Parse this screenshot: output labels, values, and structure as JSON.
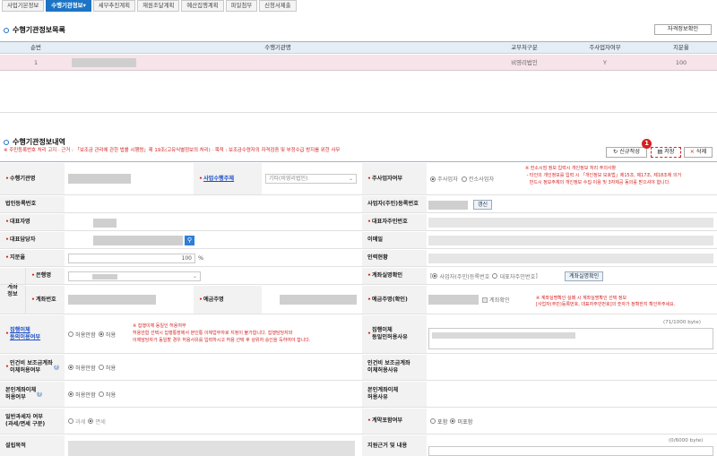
{
  "tabs": [
    "사업기본정보",
    "수행기관정보",
    "세부추진계획",
    "재원조달계획",
    "예산집행계획",
    "파일첨부",
    "신청서제출"
  ],
  "active_tab_suffix": "▾",
  "list": {
    "title": "수행기관정보목록",
    "right_button": "자격정보확인",
    "headers": [
      "순번",
      "수행기관명",
      "교부처구분",
      "주사업자여부",
      "지분율"
    ],
    "rows": [
      {
        "no": "1",
        "type": "비영리법인",
        "main": "Y",
        "share": "100"
      }
    ]
  },
  "detail": {
    "title": "수행기관정보내역",
    "subtitle": "※ 주민등록번호 처리 고지 · 근거 : 「보조금 관리에 관한 법률 시행령」제 19조(고유식별정보의 처리) · 목적 : 보조금수령자의 자격검증 및 부정수급 방지를 위한 사무",
    "buttons": {
      "new": "신규작성",
      "save": "저장",
      "delete": "삭제"
    },
    "marker": "1"
  },
  "form": {
    "org_name": "수행기관명",
    "biz_type_link": "사업수행주체",
    "biz_type_select": "기타(비영리법인)",
    "main_biz": "주사업자여부",
    "main_biz_opt1": "주사업자",
    "main_biz_opt2": "컨소사업자",
    "main_biz_note": "※ 컨소시엄 정보 입력시 개인정보 처리 주의사항\n - 타인의 개인정보를 입력 시 「개인정보 보호법」제15조, 제17조, 제18조에 의거\n   반드시 정보주체의 개인정보 수집·이용 및 3자제공 동의를 받으셔야 합니다.",
    "corp_no": "법인등록번호",
    "biz_no": "사업자(주민)등록번호",
    "verify_btn": "갱신",
    "ceo": "대표자명",
    "ceo_id": "대표자주민번호",
    "manager": "대표담당자",
    "email": "이메일",
    "share": "지분율",
    "share_value": "100",
    "share_unit": "%",
    "staff": "인력현황",
    "account_group": "계좌\n정보",
    "bank": "은행명",
    "account_verify": "계좌실명확인",
    "acct_opt1": "사업자(주민)등록번호",
    "acct_opt2": "대표자주민번호",
    "acct_verify_btn": "계좌실명확인",
    "account_no": "계좌번호",
    "depositor": "예금주명",
    "depositor_check": "예금주명(확인)",
    "acct_confirm": "계좌확인",
    "acct_note": "※ 계좌실명확인 실패 시 계좌실명확인 선택 정보\n[사업자(주민)등록번호, 대표자주민번호]의 숫자가 정확한지 확인하주세요.",
    "exec_allow": "집행이체\n동의이용여부",
    "exec_opt_no": "허용안함",
    "exec_opt_yes": "허용",
    "exec_note": "※ 집행이체 동일인 허용여부\n허용안함 선택시 집행통장에서 본인통 이체업무자로 지정이 불가합니다. 집행담당자와\n이체담당자가 동일할 경우 허용사유를 입력하시고 허용 선택 후 상위처 승인을 득하여야 합니다.",
    "exec_reason": "집행이체\n동일인허용사유",
    "byte_count1": "(71/1000 byte)",
    "labor": "인건비 보조금계좌\n이체허용여부",
    "labor_reason": "인건비 보조금계좌\n이체허용사유",
    "self": "본인계좌이체\n허용여부",
    "self_reason": "본인계좌이체\n허용사유",
    "tax": "일반과세자 여부\n(과세/면세 구분)",
    "tax_opt1": "과세",
    "tax_opt2": "면세",
    "contract": "계약포함여부",
    "contract_opt1": "포함",
    "contract_opt2": "미포함",
    "byte_count2": "(0/6000 byte)",
    "est_purpose": "설립목적",
    "support_basis": "지원근거 및 내용"
  }
}
